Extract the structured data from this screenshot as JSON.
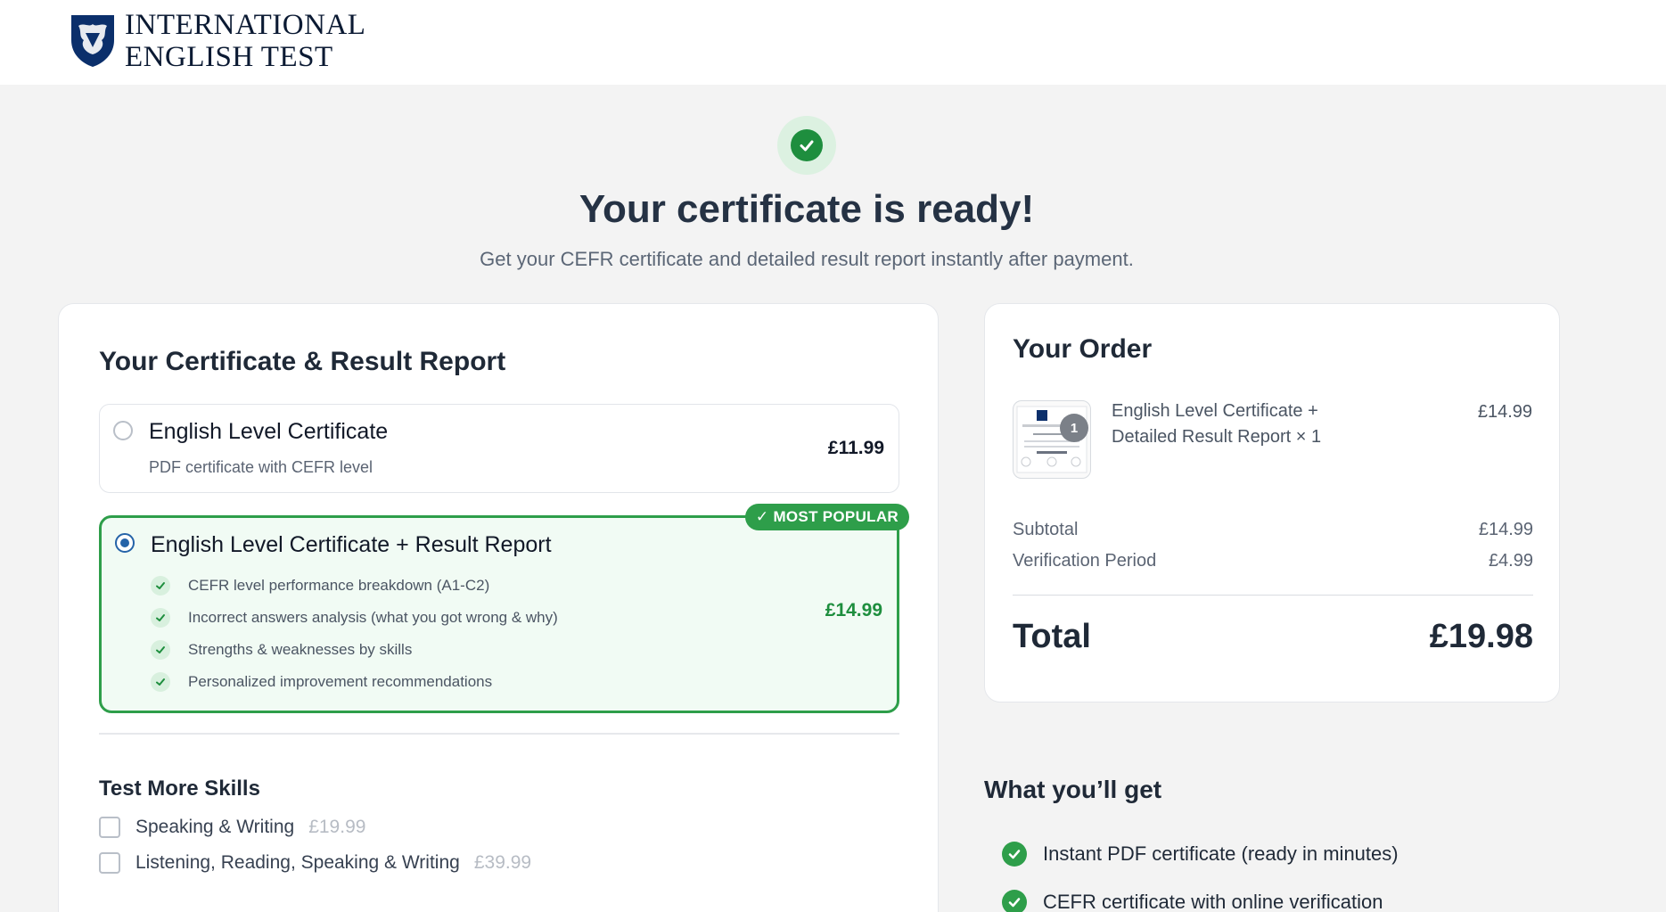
{
  "brand": {
    "line1": "INTERNATIONAL",
    "line2": "ENGLISH TEST"
  },
  "hero": {
    "title": "Your certificate is ready!",
    "subtitle": "Get your CEFR certificate and detailed result report instantly after payment."
  },
  "product": {
    "section_title": "Your Certificate & Result Report",
    "option1": {
      "title": "English Level Certificate",
      "description": "PDF certificate with CEFR level",
      "price": "£11.99",
      "selected": false
    },
    "option2": {
      "badge": "✓ MOST POPULAR",
      "title": "English Level Certificate + Result Report",
      "features": [
        "CEFR level performance breakdown (A1-C2)",
        "Incorrect answers analysis (what you got wrong & why)",
        "Strengths & weaknesses by skills",
        "Personalized improvement recommendations"
      ],
      "price": "£14.99",
      "selected": true
    }
  },
  "more_skills": {
    "title": "Test More Skills",
    "items": [
      {
        "label": "Speaking & Writing",
        "price": "£19.99",
        "checked": false
      },
      {
        "label": "Listening, Reading, Speaking & Writing",
        "price": "£39.99",
        "checked": false
      }
    ]
  },
  "order": {
    "title": "Your Order",
    "item": {
      "name_line1": "English Level Certificate +",
      "name_line2": "Detailed Result Report × 1",
      "price": "£14.99",
      "quantity": "1"
    },
    "subtotal_label": "Subtotal",
    "subtotal_value": "£14.99",
    "verification_label": "Verification Period",
    "verification_value": "£4.99",
    "total_label": "Total",
    "total_value": "£19.98"
  },
  "benefits": {
    "title": "What you’ll get",
    "items": [
      "Instant PDF certificate (ready in minutes)",
      "CEFR certificate with online verification"
    ]
  },
  "colors": {
    "accent_green": "#2e9e4a",
    "success_green": "#1e8e3e",
    "radio_blue": "#2563a8",
    "brand_navy": "#0b1a33"
  }
}
